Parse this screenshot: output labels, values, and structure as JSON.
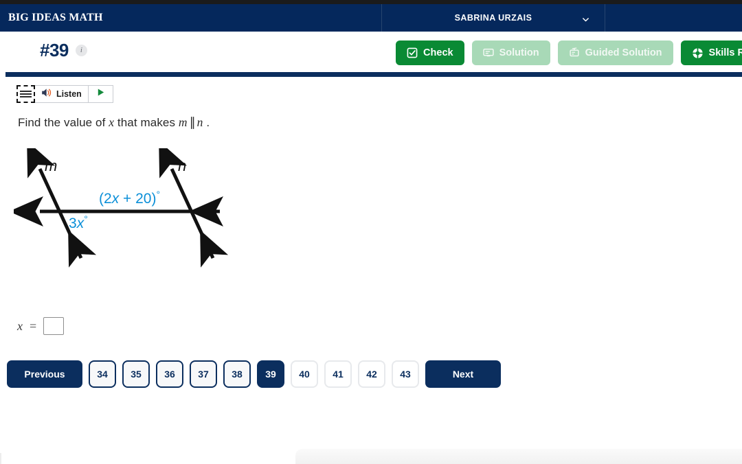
{
  "header": {
    "brand": "BIG IDEAS MATH",
    "user_name": "SABRINA URZAIS",
    "chevron_icon": "chevron-down-icon",
    "navy": "#05285c"
  },
  "subheader": {
    "question_number": "#39",
    "info_icon": "info-icon",
    "info_label": "i",
    "actions": [
      {
        "label": "Check",
        "icon": "check-square-icon",
        "state": "enabled",
        "color": "#0a8a34"
      },
      {
        "label": "Solution",
        "icon": "solution-screen-icon",
        "state": "disabled",
        "color": "#a8d9b7"
      },
      {
        "label": "Guided Solution",
        "icon": "guided-solution-icon",
        "state": "disabled",
        "color": "#a8d9b7"
      },
      {
        "label": "Skills Re",
        "icon": "lifesaver-icon",
        "state": "enabled",
        "color": "#0a8a34"
      }
    ]
  },
  "listen_toolbar": {
    "drag_handle_icon": "drag-lines-icon",
    "speaker_icon": "speaker-icon",
    "listen_label": "Listen",
    "play_icon": "play-icon"
  },
  "prompt": {
    "part1": "Find the value of",
    "var_x": "x",
    "part2": "that makes",
    "var_m": "m",
    "parallel_symbol": "∥",
    "var_n": "n",
    "period": "."
  },
  "figure": {
    "label_m": "m",
    "label_n": "n",
    "angle_top": "(2x + 20)°",
    "angle_top_coef": "2",
    "angle_top_var": "x",
    "angle_bottom": "3x°",
    "angle_bottom_coef": "3",
    "angle_bottom_var": "x",
    "angle_color": "#0b8fd8",
    "line_color": "#111111"
  },
  "answer": {
    "var_label": "x",
    "equals": "=",
    "value": "",
    "placeholder": ""
  },
  "pagination": {
    "previous_label": "Previous",
    "next_label": "Next",
    "pages": [
      {
        "label": "34",
        "state": "visited"
      },
      {
        "label": "35",
        "state": "visited"
      },
      {
        "label": "36",
        "state": "visited"
      },
      {
        "label": "37",
        "state": "visited"
      },
      {
        "label": "38",
        "state": "visited"
      },
      {
        "label": "39",
        "state": "current"
      },
      {
        "label": "40",
        "state": "plain"
      },
      {
        "label": "41",
        "state": "plain"
      },
      {
        "label": "42",
        "state": "plain"
      },
      {
        "label": "43",
        "state": "plain"
      }
    ]
  }
}
